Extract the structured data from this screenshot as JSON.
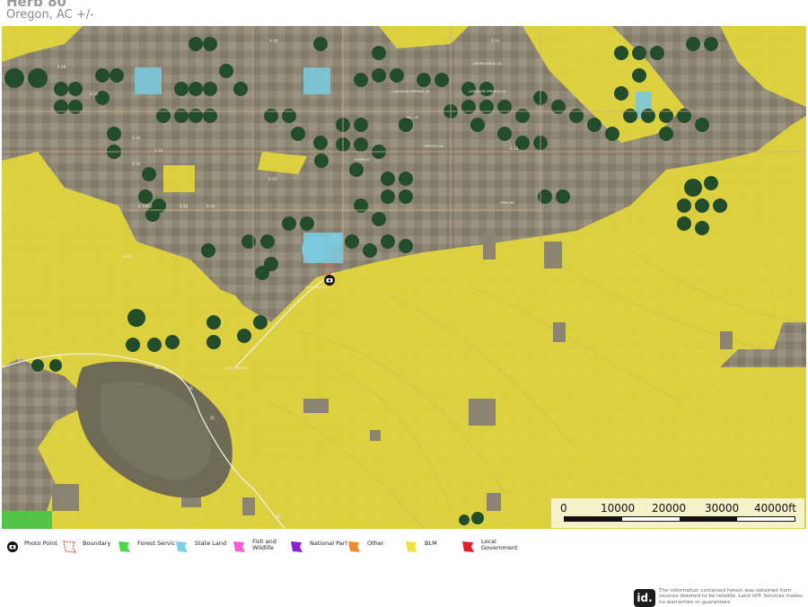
{
  "header": {
    "title": "Herb 80",
    "subtitle": "Oregon,  AC +/-"
  },
  "map": {
    "road_labels": [
      "S-18",
      "S-14",
      "S-14",
      "S-14",
      "S-14",
      "S-14A",
      "S-14",
      "S-14",
      "S-14",
      "S-14",
      "S-18",
      "S-14",
      "S-14"
    ],
    "street_labels": [
      "HAHEN RIDGE LN",
      "LANGDON SPRINGS LN",
      "LANGDON SPRINGS LN",
      "MILL LN",
      "THORN ST",
      "TERN RD",
      "OLD LAKE RD",
      "OLD LAKE RD",
      "CRYSTAL LN"
    ],
    "highway_labels": [
      "31",
      "31",
      "31",
      "31",
      "31",
      "31"
    ],
    "colors": {
      "imagery_base": "#8d8672",
      "blm": "#e3d73c",
      "state_land": "#7cc8dc",
      "forest_service": "#45c24a",
      "pivot": "#234d2a"
    }
  },
  "scale_bar": {
    "labels": [
      "0",
      "10000",
      "20000",
      "30000",
      "40000ft"
    ]
  },
  "legend": {
    "items": [
      {
        "label": "Photo Point",
        "icon": "camera-icon",
        "color": "#111111"
      },
      {
        "label": "Boundary",
        "icon": "boundary-icon",
        "color": "#e05a4a"
      },
      {
        "label": "Forest Servic",
        "icon": "polygon-icon",
        "color": "#4cd64c"
      },
      {
        "label": "State Land",
        "icon": "polygon-icon",
        "color": "#7ccfe6"
      },
      {
        "label": "Fish and Wildlife",
        "icon": "polygon-icon",
        "color": "#ff5ad9"
      },
      {
        "label": "National Parl",
        "icon": "polygon-icon",
        "color": "#8a1fd6"
      },
      {
        "label": "Other",
        "icon": "polygon-icon",
        "color": "#f58b2a"
      },
      {
        "label": "BLM",
        "icon": "polygon-icon",
        "color": "#f3e13a"
      },
      {
        "label": "Local Government",
        "icon": "polygon-icon",
        "color": "#e01f2a"
      }
    ]
  },
  "footer": {
    "logo_text": "id.",
    "disclaimer": "The information contained herein was obtained from sources deemed to be reliable. Land id® Services makes no warranties or guarantees"
  }
}
